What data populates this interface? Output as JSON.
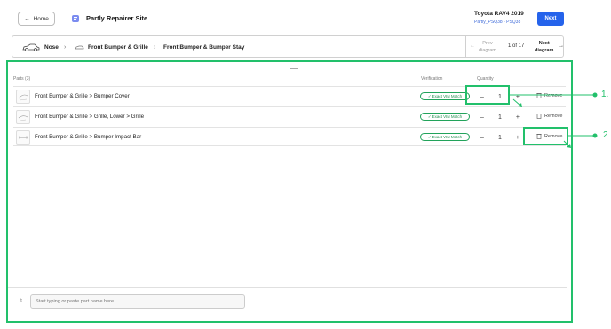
{
  "header": {
    "home_label": "Home",
    "site_title": "Partly Repairer Site",
    "vehicle_title": "Toyota RAV4 2019",
    "vehicle_sub": "Partly_PSQ38 - PSQ38",
    "next_label": "Next"
  },
  "breadcrumb": {
    "items": [
      "Nose",
      "Front Bumper & Grille",
      "Front Bumper & Bumper Stay"
    ]
  },
  "pager": {
    "prev_line1": "Prev",
    "prev_line2": "diagram",
    "page_of": "1 of 17",
    "next_line1": "Next",
    "next_line2": "diagram"
  },
  "table": {
    "parts_header": "Parts (3)",
    "verification_header": "Verification",
    "quantity_header": "Quantity",
    "rows": [
      {
        "name": "Front Bumper & Grille > Bumper Cover",
        "verification": "Exact VIN Match",
        "qty": "1",
        "remove": "Remove"
      },
      {
        "name": "Front Bumper & Grille > Grille, Lower > Grille",
        "verification": "Exact VIN Match",
        "qty": "1",
        "remove": "Remove"
      },
      {
        "name": "Front Bumper & Grille > Bumper Impact Bar",
        "verification": "Exact VIN Match",
        "qty": "1",
        "remove": "Remove"
      }
    ]
  },
  "search": {
    "placeholder": "Start typing or paste part name here"
  },
  "callouts": [
    "1.",
    "2"
  ],
  "colors": {
    "accent": "#2563eb",
    "highlight": "#22c06b"
  }
}
